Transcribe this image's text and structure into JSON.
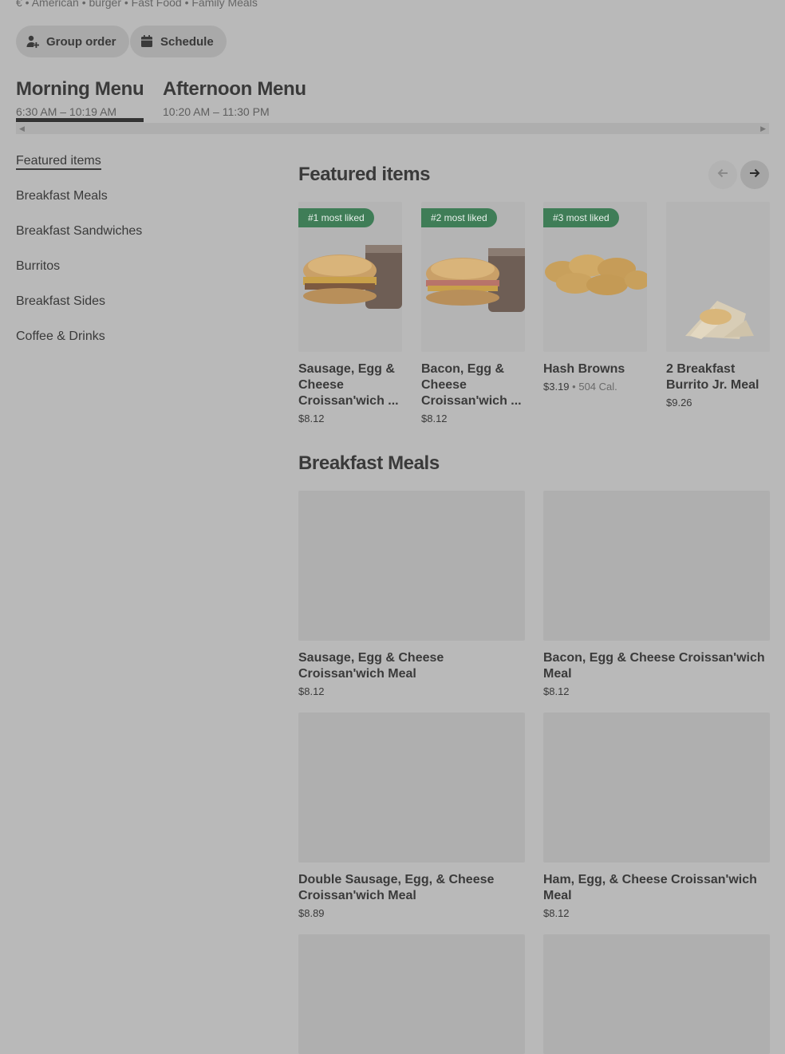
{
  "header": {
    "tags": "€ • American • burger • Fast Food • Family Meals",
    "group_order_label": "Group order",
    "schedule_label": "Schedule"
  },
  "menus": [
    {
      "title": "Morning Menu",
      "hours": "6:30 AM – 10:19 AM"
    },
    {
      "title": "Afternoon Menu",
      "hours": "10:20 AM – 11:30 PM"
    }
  ],
  "sidebar": {
    "items": [
      {
        "label": "Featured items"
      },
      {
        "label": "Breakfast Meals"
      },
      {
        "label": "Breakfast Sandwiches"
      },
      {
        "label": "Burritos"
      },
      {
        "label": "Breakfast Sides"
      },
      {
        "label": "Coffee & Drinks"
      }
    ]
  },
  "featured": {
    "title": "Featured items",
    "items": [
      {
        "badge": "#1 most liked",
        "name": "Sausage, Egg & Cheese Croissan'wich ...",
        "price": "$8.12",
        "calories": ""
      },
      {
        "badge": "#2 most liked",
        "name": "Bacon, Egg & Cheese Croissan'wich ...",
        "price": "$8.12",
        "calories": ""
      },
      {
        "badge": "#3 most liked",
        "name": "Hash Browns",
        "price": "$3.19",
        "calories": "504 Cal."
      },
      {
        "badge": "",
        "name": "2 Breakfast Burrito Jr. Meal",
        "price": "$9.26",
        "calories": ""
      }
    ]
  },
  "breakfast_meals": {
    "title": "Breakfast Meals",
    "items": [
      {
        "name": "Sausage, Egg & Cheese Croissan'wich Meal",
        "price": "$8.12"
      },
      {
        "name": "Bacon, Egg & Cheese Croissan'wich Meal",
        "price": "$8.12"
      },
      {
        "name": "Double Sausage, Egg, & Cheese Croissan'wich Meal",
        "price": "$8.89"
      },
      {
        "name": "Ham, Egg, & Cheese Croissan'wich Meal",
        "price": "$8.12"
      },
      {
        "name": "",
        "price": ""
      },
      {
        "name": "",
        "price": ""
      }
    ]
  },
  "colors": {
    "overlay_background": "#b9b9b9",
    "badge_green": "#3f7d57",
    "text": "#3a3a3a"
  }
}
